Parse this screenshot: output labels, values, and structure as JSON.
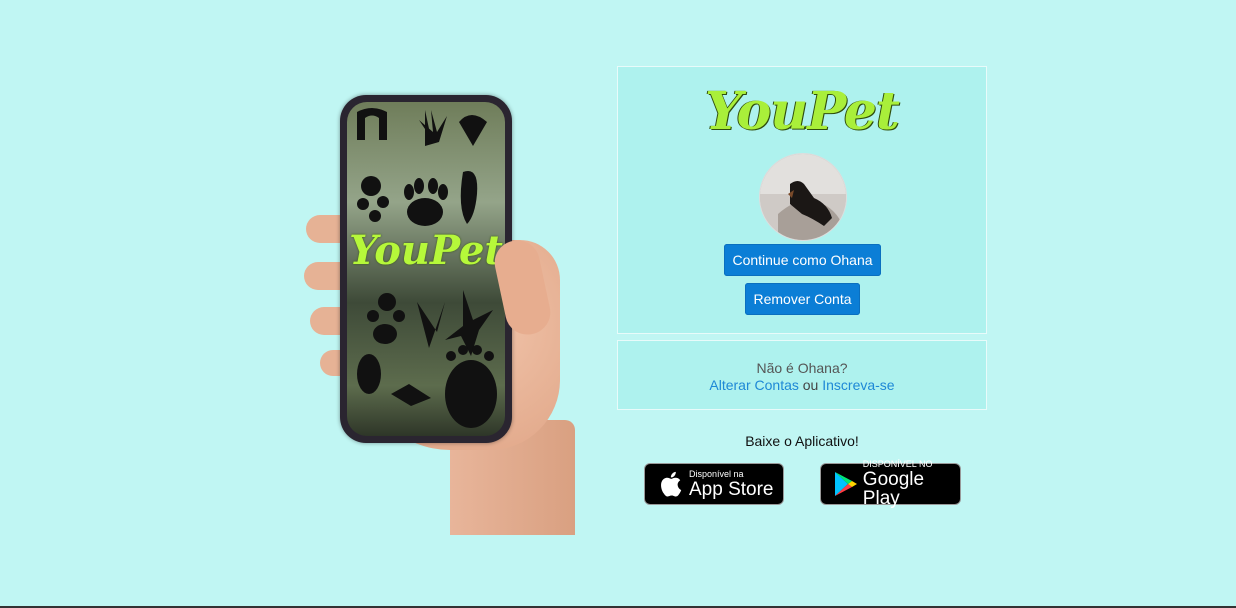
{
  "phone": {
    "brand": "YouPet"
  },
  "login": {
    "logo": "YouPet",
    "continue_label": "Continue como Ohana",
    "remove_label": "Remover Conta",
    "not_user": "Não é Ohana?",
    "switch_link": "Alterar Contas",
    "or": "ou",
    "signup_link": "Inscreva-se"
  },
  "download": {
    "title": "Baixe o Aplicativo!",
    "apple_small": "Disponível na",
    "apple_big": "App Store",
    "google_small": "DISPONÍVEL NO",
    "google_big": "Google Play"
  },
  "colors": {
    "background": "#c0f6f3",
    "panel": "#aef2ee",
    "button": "#0b7ed6",
    "link": "#1e88d6",
    "logo": "#a9ef3a"
  }
}
